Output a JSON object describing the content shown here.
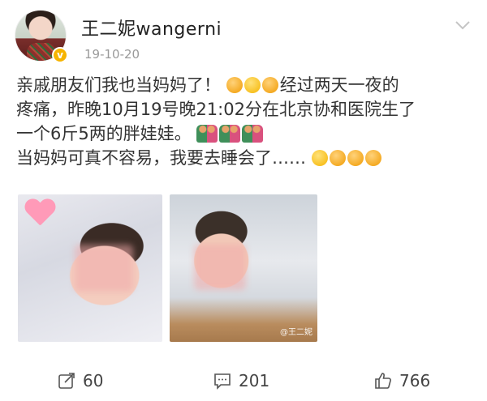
{
  "post": {
    "username": "王二妮wangerni",
    "date": "19-10-20",
    "text_lines": [
      "亲戚朋友们我也当妈妈了！",
      "经过两天一夜的",
      "疼痛，昨晚10月19号晚21:02分在北京协和医院生了",
      "一个6斤5两的胖娃娃。",
      "当妈妈可真不容易，我要去睡会了……"
    ],
    "watermark": "@王二妮",
    "icons": {
      "verified": "verified-badge-icon",
      "menu": "chevron-down-icon",
      "repost": "repost-icon",
      "comment": "comment-icon",
      "like": "thumbs-up-icon"
    }
  },
  "actions": {
    "repost_count": "60",
    "comment_count": "201",
    "like_count": "766"
  },
  "colors": {
    "username": "#222222",
    "date": "#9a9a9a",
    "text": "#333333",
    "verified": "#f6b400"
  }
}
